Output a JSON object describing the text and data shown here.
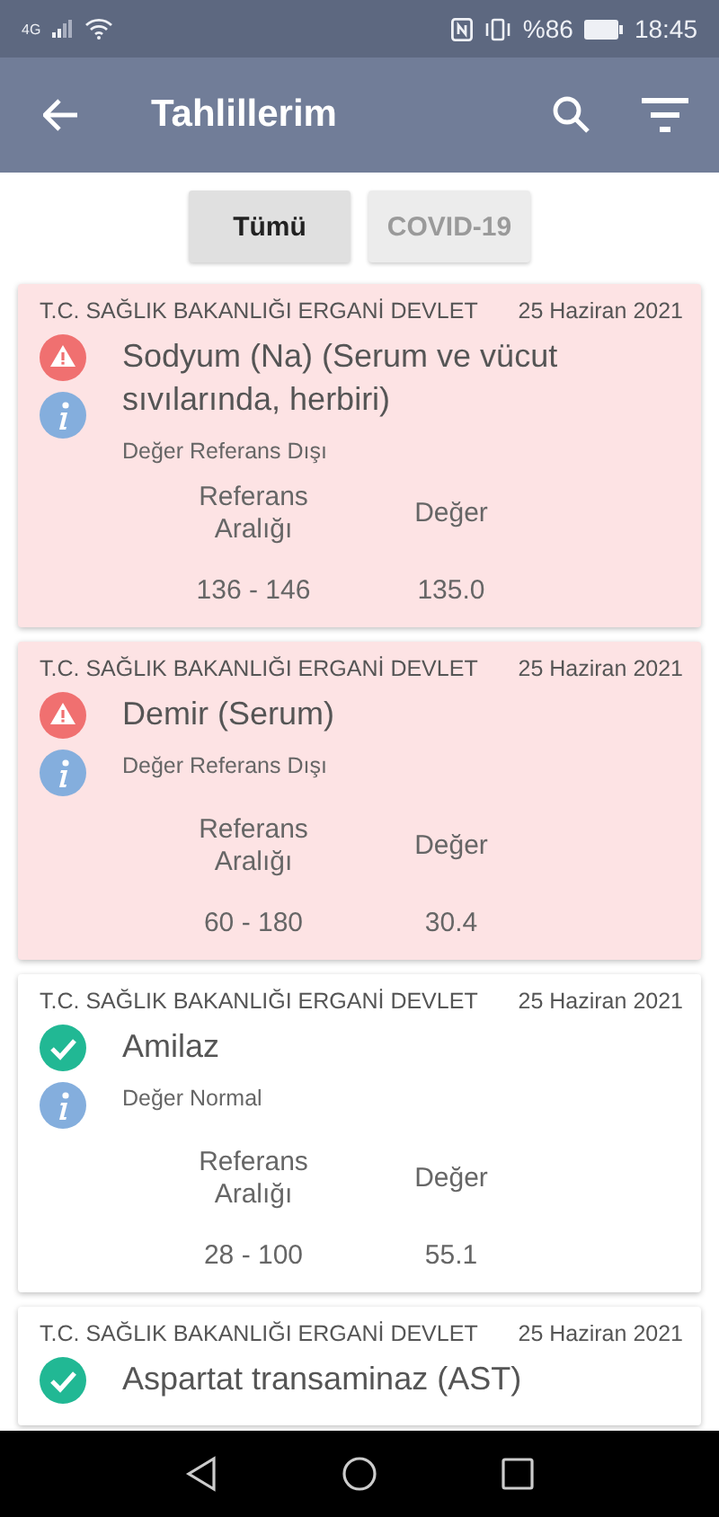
{
  "status_bar": {
    "network": "4G",
    "battery_text": "%86",
    "time": "18:45"
  },
  "app_bar": {
    "title": "Tahlillerim"
  },
  "tabs": [
    {
      "label": "Tümü",
      "selected": true
    },
    {
      "label": "COVID-19",
      "selected": false
    }
  ],
  "results": [
    {
      "hospital": "T.C. SAĞLIK BAKANLIĞI ERGANİ DEVLET",
      "date": "25 Haziran 2021",
      "name": "Sodyum (Na) (Serum ve vücut sıvılarında, herbiri)",
      "kind": "abnormal",
      "status": "Değer Referans Dışı",
      "range_label": "Referans Aralığı",
      "value_label": "Değer",
      "range": "136 - 146",
      "value": "135.0"
    },
    {
      "hospital": "T.C. SAĞLIK BAKANLIĞI ERGANİ DEVLET",
      "date": "25 Haziran 2021",
      "name": "Demir (Serum)",
      "kind": "abnormal",
      "status": "Değer Referans Dışı",
      "range_label": "Referans Aralığı",
      "value_label": "Değer",
      "range": "60 - 180",
      "value": "30.4"
    },
    {
      "hospital": "T.C. SAĞLIK BAKANLIĞI ERGANİ DEVLET",
      "date": "25 Haziran 2021",
      "name": "Amilaz",
      "kind": "normal",
      "status": "Değer Normal",
      "range_label": "Referans Aralığı",
      "value_label": "Değer",
      "range": "28 - 100",
      "value": "55.1"
    },
    {
      "hospital": "T.C. SAĞLIK BAKANLIĞI ERGANİ DEVLET",
      "date": "25 Haziran 2021",
      "name": "Aspartat transaminaz (AST)",
      "kind": "normal"
    }
  ]
}
